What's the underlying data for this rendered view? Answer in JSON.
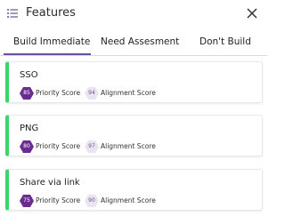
{
  "header": {
    "title": "Features",
    "menu_icon": "list-icon",
    "close_icon": "close-icon"
  },
  "tabs": [
    {
      "label": "Build Immediate",
      "active": true
    },
    {
      "label": "Need Assesment",
      "active": false
    },
    {
      "label": "Don't Build",
      "active": false
    }
  ],
  "colors": {
    "accent": "#6b4fa0",
    "card_stripe": "#3ad66a",
    "priority_badge": "#6a2c91",
    "alignment_badge": "#e9e3f2"
  },
  "features": [
    {
      "name": "SSO",
      "priority_score": "85",
      "priority_label": "Priority Score",
      "alignment_score": "94",
      "alignment_label": "Alignment Score"
    },
    {
      "name": "PNG",
      "priority_score": "80",
      "priority_label": "Priority Score",
      "alignment_score": "97",
      "alignment_label": "Alignment Score"
    },
    {
      "name": "Share via link",
      "priority_score": "75",
      "priority_label": "Priority Score",
      "alignment_score": "90",
      "alignment_label": "Alignment Score"
    }
  ]
}
